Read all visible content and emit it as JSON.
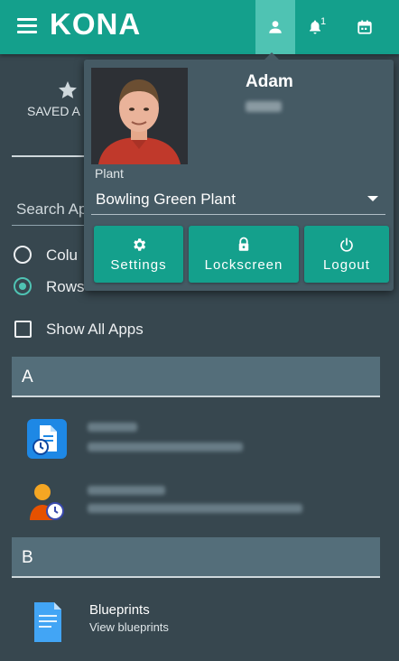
{
  "app": {
    "brand": "KONA"
  },
  "topbar": {
    "notifications_count": "1",
    "icons": [
      "menu-icon",
      "person-icon",
      "bell-icon",
      "calendar-icon"
    ]
  },
  "sidebar": {
    "saved_apps_label": "SAVED A",
    "search_placeholder": "Search Ap",
    "view_options": [
      {
        "label": "Colu",
        "selected": false
      },
      {
        "label": "Rows",
        "selected": true
      }
    ],
    "show_all_apps_label": "Show All Apps",
    "show_all_apps_checked": false
  },
  "sections": [
    {
      "letter": "A"
    },
    {
      "letter": "B"
    }
  ],
  "apps": [
    {
      "title": "Blueprints",
      "subtitle": "View blueprints"
    }
  ],
  "profile_menu": {
    "user_name": "Adam",
    "plant_label": "Plant",
    "plant_value": "Bowling Green Plant",
    "buttons": [
      {
        "label": "Settings",
        "icon": "gear-icon"
      },
      {
        "label": "Lockscreen",
        "icon": "lock-icon"
      },
      {
        "label": "Logout",
        "icon": "power-icon"
      }
    ]
  },
  "colors": {
    "primary": "#14a08c",
    "background": "#37474f",
    "panel": "#455a64",
    "section": "#546e7a",
    "accent": "#4fc3b3"
  }
}
